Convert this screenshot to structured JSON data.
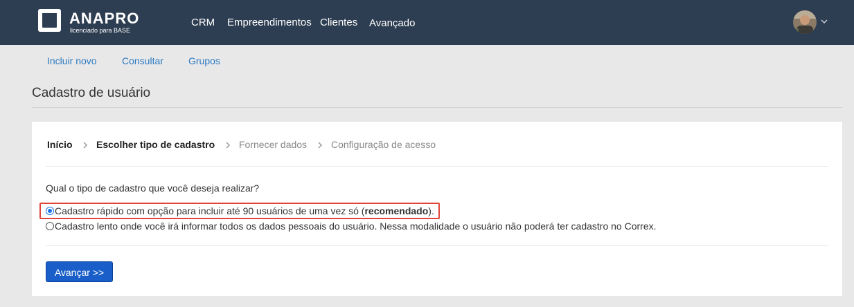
{
  "brand": {
    "name": "ANAPRO",
    "tagline": "licenciado para BASE"
  },
  "nav": [
    "CRM",
    "Empreendimentos",
    "Clientes",
    "Avançado"
  ],
  "subnav": [
    "Incluir novo",
    "Consultar",
    "Grupos"
  ],
  "page_title": "Cadastro de usuário",
  "wizard_steps": [
    {
      "label": "Início",
      "state": "done"
    },
    {
      "label": "Escolher tipo de cadastro",
      "state": "current"
    },
    {
      "label": "Fornecer dados",
      "state": "todo"
    },
    {
      "label": "Configuração de acesso",
      "state": "todo"
    }
  ],
  "question": "Qual o tipo de cadastro que você deseja realizar?",
  "options": [
    {
      "text_before": "Cadastro rápido com opção para incluir até 90 usuários de uma vez só (",
      "text_bold": "recomendado",
      "text_after": ").",
      "selected": true
    },
    {
      "text": "Cadastro lento onde você irá informar todos os dados pessoais do usuário. Nessa modalidade o usuário não poderá ter cadastro no Correx.",
      "selected": false
    }
  ],
  "next_button": "Avançar >>",
  "colors": {
    "topbar": "#2e3e52",
    "link": "#2a7ac0",
    "primary": "#1a5fc9",
    "highlight": "#e1453a"
  },
  "icons": {
    "logo": "anapro-logo-icon",
    "avatar": "user-avatar",
    "caret": "chevron-down-icon",
    "step_separator": "chevron-right-icon"
  }
}
